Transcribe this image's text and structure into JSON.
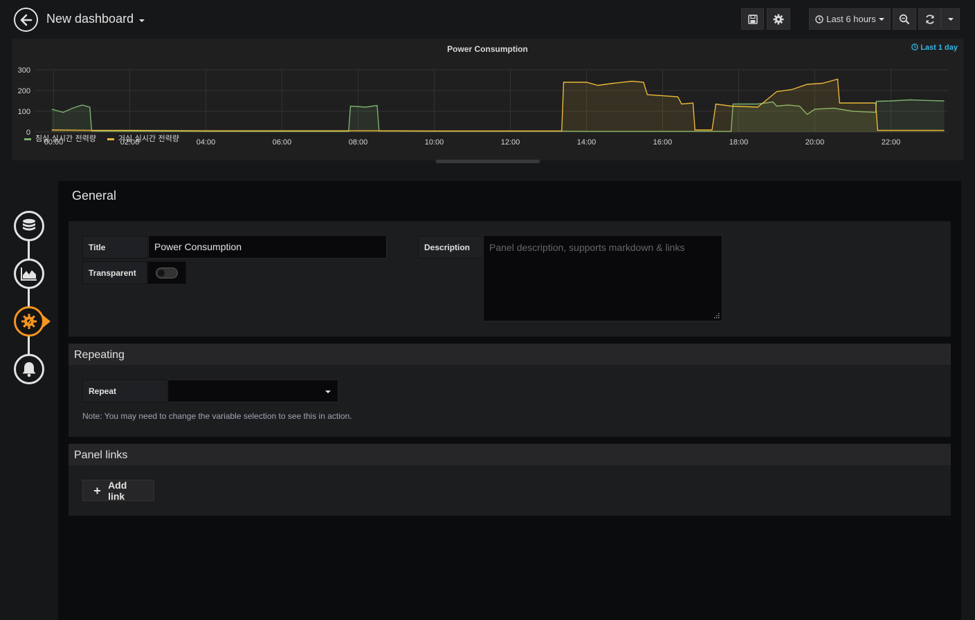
{
  "header": {
    "dashboard_title": "New dashboard",
    "time_range_label": "Last 6 hours",
    "icons": [
      "back-arrow-icon",
      "save-icon",
      "gear-icon",
      "clock-icon",
      "zoom-out-icon",
      "refresh-icon",
      "chevron-down-icon"
    ]
  },
  "panel": {
    "title": "Power Consumption",
    "time_override": "Last 1 day"
  },
  "chart_data": {
    "type": "area",
    "title": "Power Consumption",
    "ylim": [
      0,
      300
    ],
    "y_ticks": [
      "0",
      "100",
      "200",
      "300"
    ],
    "x_ticks": [
      "00:00",
      "02:00",
      "04:00",
      "06:00",
      "08:00",
      "10:00",
      "12:00",
      "14:00",
      "16:00",
      "18:00",
      "20:00",
      "22:00"
    ],
    "grid": true,
    "legend_position": "bottom-left",
    "series": [
      {
        "name": "침실 실시간 전력량",
        "color": "#7eb26d",
        "points": [
          [
            -0.05,
            110
          ],
          [
            0.25,
            95
          ],
          [
            0.5,
            115
          ],
          [
            0.75,
            130
          ],
          [
            0.95,
            120
          ],
          [
            1.0,
            5
          ],
          [
            3.0,
            4
          ],
          [
            5.0,
            3
          ],
          [
            7.75,
            3
          ],
          [
            7.8,
            125
          ],
          [
            8.2,
            120
          ],
          [
            8.5,
            128
          ],
          [
            8.55,
            5
          ],
          [
            10,
            4
          ],
          [
            12,
            4
          ],
          [
            13.5,
            4
          ],
          [
            14,
            3
          ],
          [
            16,
            3
          ],
          [
            17.8,
            3
          ],
          [
            17.85,
            135
          ],
          [
            18.5,
            135
          ],
          [
            18.9,
            145
          ],
          [
            19.0,
            125
          ],
          [
            19.3,
            130
          ],
          [
            19.6,
            125
          ],
          [
            19.8,
            85
          ],
          [
            20.0,
            110
          ],
          [
            20.5,
            115
          ],
          [
            21.0,
            100
          ],
          [
            21.6,
            95
          ],
          [
            21.62,
            148
          ],
          [
            22.0,
            150
          ],
          [
            22.5,
            155
          ],
          [
            23.0,
            152
          ],
          [
            23.4,
            150
          ]
        ]
      },
      {
        "name": "거실 실시간 전력량",
        "color": "#eab839",
        "points": [
          [
            -0.05,
            10
          ],
          [
            1.0,
            8
          ],
          [
            2.0,
            8
          ],
          [
            4.0,
            6
          ],
          [
            7.8,
            6
          ],
          [
            8.5,
            6
          ],
          [
            10,
            5
          ],
          [
            12,
            5
          ],
          [
            13.35,
            5
          ],
          [
            13.4,
            240
          ],
          [
            14.0,
            240
          ],
          [
            14.3,
            225
          ],
          [
            14.7,
            235
          ],
          [
            15.2,
            245
          ],
          [
            15.5,
            240
          ],
          [
            15.6,
            180
          ],
          [
            16.4,
            170
          ],
          [
            16.5,
            135
          ],
          [
            16.8,
            140
          ],
          [
            16.85,
            10
          ],
          [
            17.3,
            10
          ],
          [
            17.4,
            135
          ],
          [
            17.8,
            125
          ],
          [
            18.5,
            120
          ],
          [
            18.8,
            165
          ],
          [
            19.0,
            195
          ],
          [
            19.4,
            205
          ],
          [
            19.8,
            230
          ],
          [
            20.2,
            235
          ],
          [
            20.6,
            255
          ],
          [
            20.65,
            140
          ],
          [
            21.6,
            140
          ],
          [
            21.65,
            8
          ],
          [
            23.4,
            8
          ]
        ]
      }
    ]
  },
  "editor": {
    "section_title": "General",
    "title_label": "Title",
    "title_value": "Power Consumption",
    "transparent_label": "Transparent",
    "transparent_on": false,
    "description_label": "Description",
    "description_placeholder": "Panel description, supports markdown & links",
    "repeating_title": "Repeating",
    "repeat_label": "Repeat",
    "repeat_value": "",
    "repeat_note": "Note: You may need to change the variable selection to see this in action.",
    "panel_links_title": "Panel links",
    "add_link_label": "Add link"
  },
  "steps": [
    "queries-step",
    "visualization-step",
    "general-step",
    "alert-step"
  ],
  "colors": {
    "accent": "#f79520",
    "link": "#33b5e5",
    "background": "#161719"
  }
}
